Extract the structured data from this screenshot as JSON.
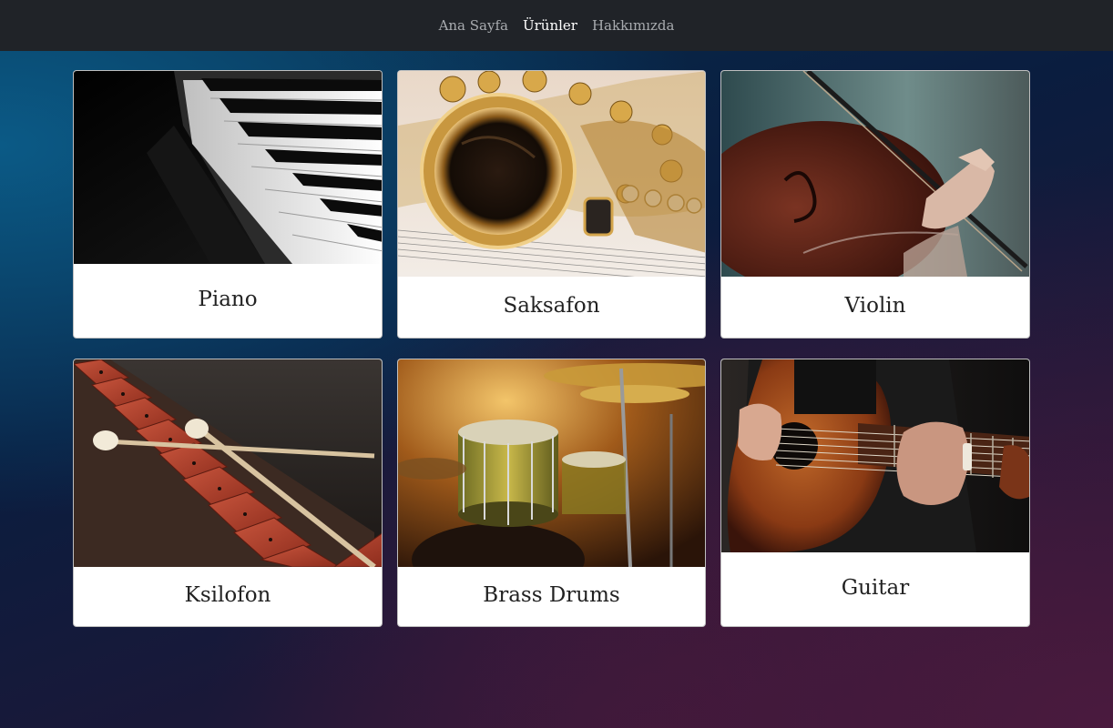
{
  "nav": {
    "items": [
      {
        "label": "Ana Sayfa",
        "active": false
      },
      {
        "label": "Ürünler",
        "active": true
      },
      {
        "label": "Hakkımızda",
        "active": false
      }
    ]
  },
  "products": [
    {
      "title": "Piano",
      "image": "piano-keys-photo"
    },
    {
      "title": "Saksafon",
      "image": "saxophone-photo"
    },
    {
      "title": "Violin",
      "image": "violin-photo"
    },
    {
      "title": "Ksilofon",
      "image": "xylophone-photo"
    },
    {
      "title": "Brass Drums",
      "image": "drum-kit-photo"
    },
    {
      "title": "Guitar",
      "image": "acoustic-guitar-photo"
    }
  ]
}
